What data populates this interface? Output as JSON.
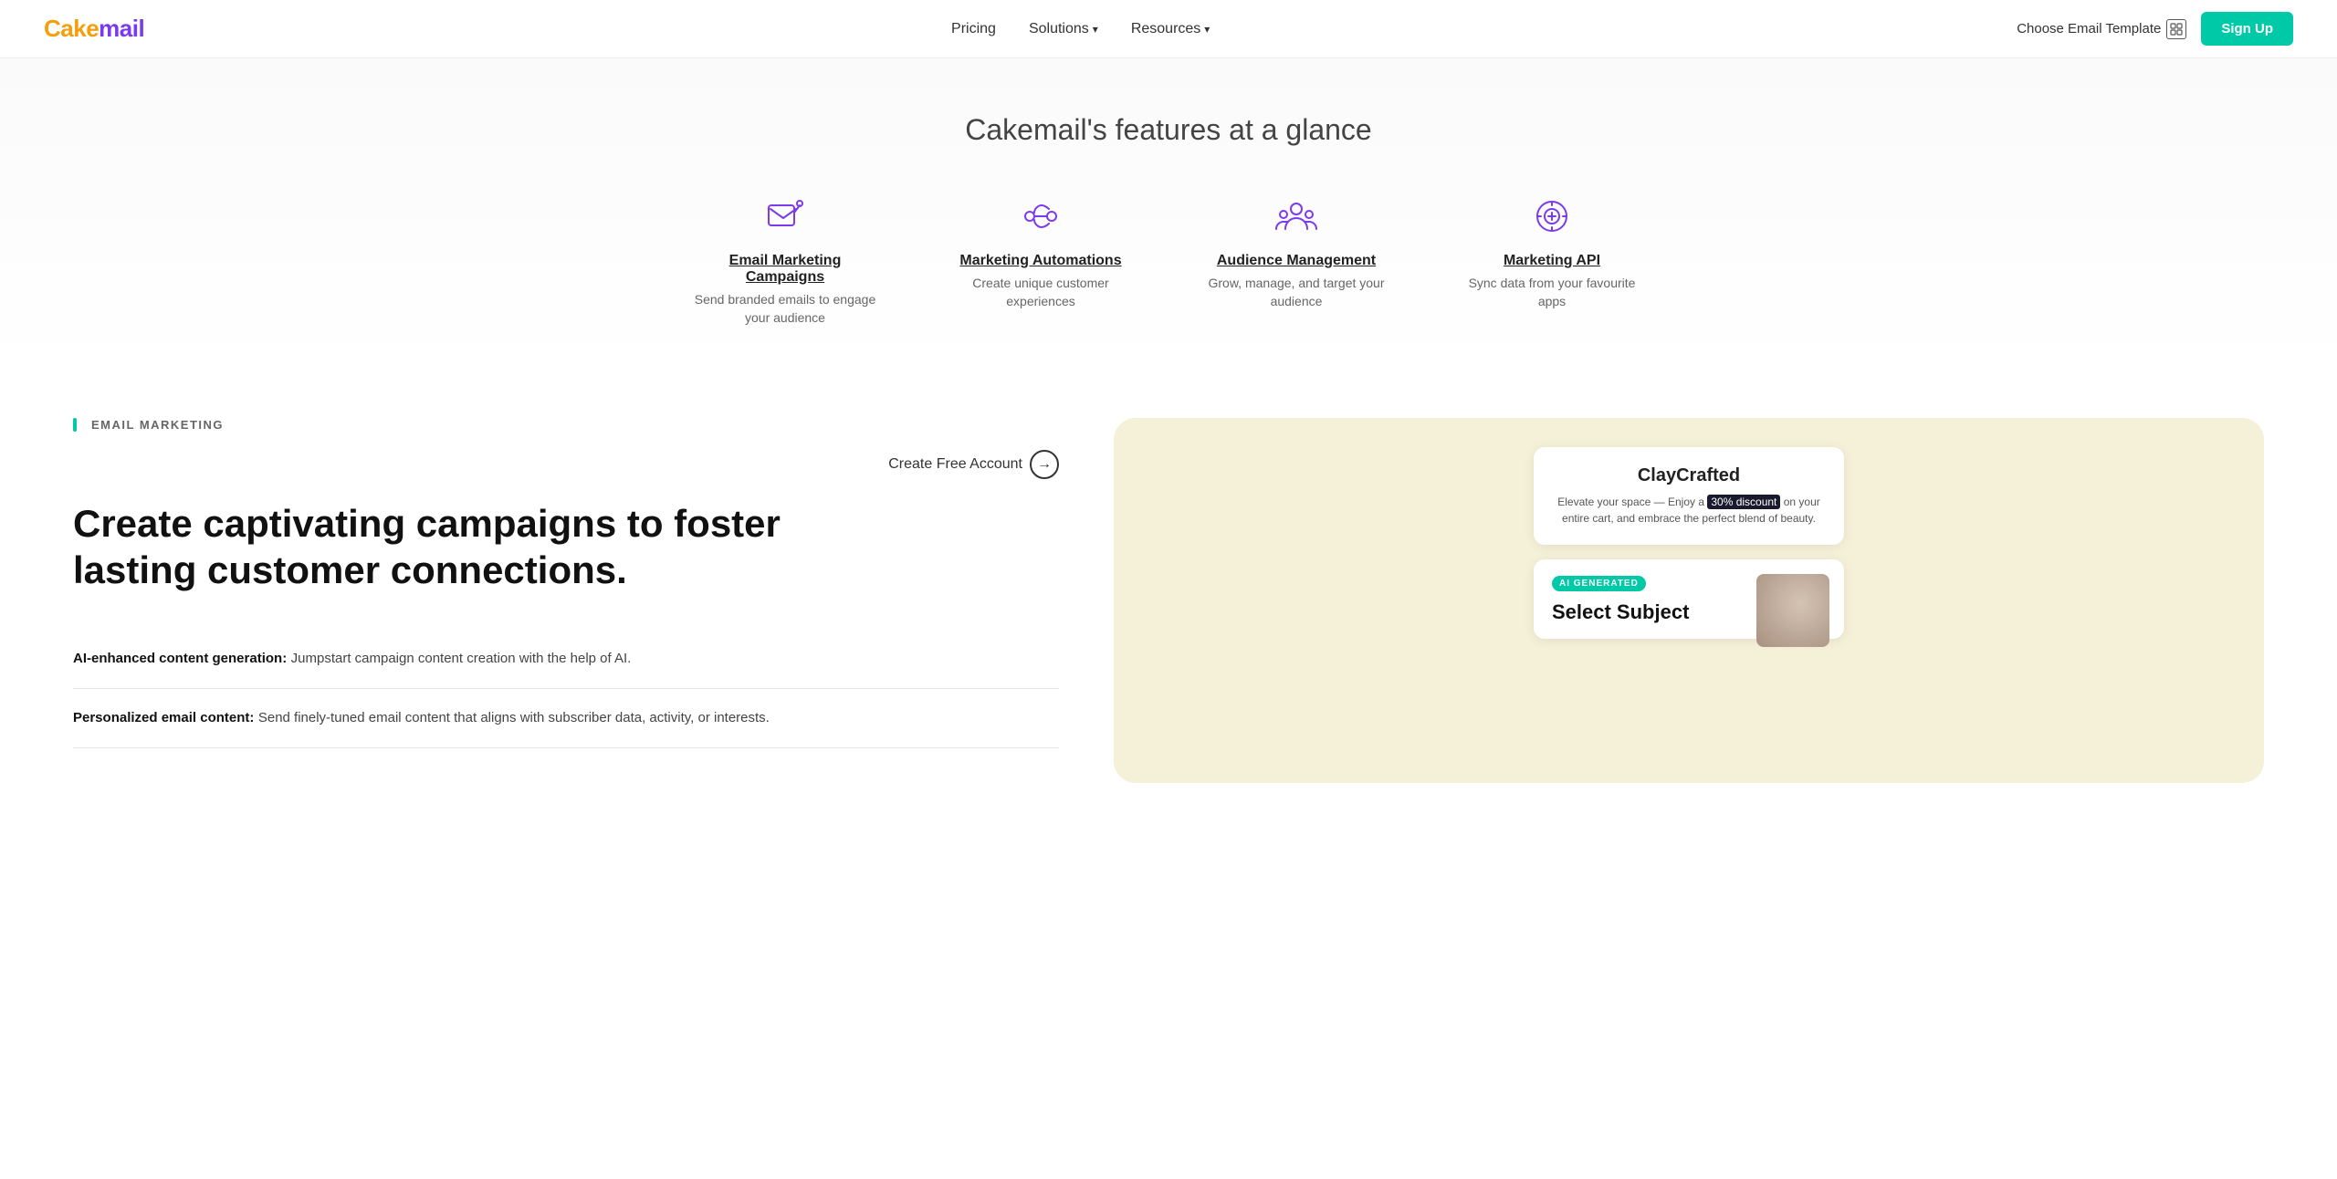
{
  "brand": {
    "name_part1": "Cake",
    "name_part2": "mail"
  },
  "nav": {
    "pricing": "Pricing",
    "solutions": "Solutions",
    "resources": "Resources",
    "choose_template": "Choose Email Template",
    "signup": "Sign Up"
  },
  "features_section": {
    "title": "Cakemail's features at a glance",
    "items": [
      {
        "icon": "email-marketing-icon",
        "title": "Email Marketing Campaigns",
        "desc": "Send branded emails to engage your audience"
      },
      {
        "icon": "automations-icon",
        "title": "Marketing Automations",
        "desc": "Create unique customer experiences"
      },
      {
        "icon": "audience-icon",
        "title": "Audience Management",
        "desc": "Grow, manage, and target your audience"
      },
      {
        "icon": "api-icon",
        "title": "Marketing API",
        "desc": "Sync data from your favourite apps"
      }
    ]
  },
  "email_marketing": {
    "label": "EMAIL MARKETING",
    "headline_line1": "Create captivating campaigns to foster",
    "headline_line2": "lasting customer connections.",
    "create_free_account": "Create Free Account",
    "features": [
      {
        "title": "AI-enhanced content generation:",
        "text": " Jumpstart campaign content creation with the help of AI."
      },
      {
        "title": "Personalized email content:",
        "text": " Send finely-tuned email content that aligns with subscriber data, activity, or interests."
      }
    ]
  },
  "preview": {
    "company": "ClayCrafted",
    "email_text_before": "Elevate your space — Enjoy a ",
    "email_highlight": "30% discount",
    "email_text_after": " on your entire cart, and embrace the perfect blend of beauty.",
    "ai_badge": "AI GENERATED",
    "ai_card_title": "Select Subject"
  }
}
